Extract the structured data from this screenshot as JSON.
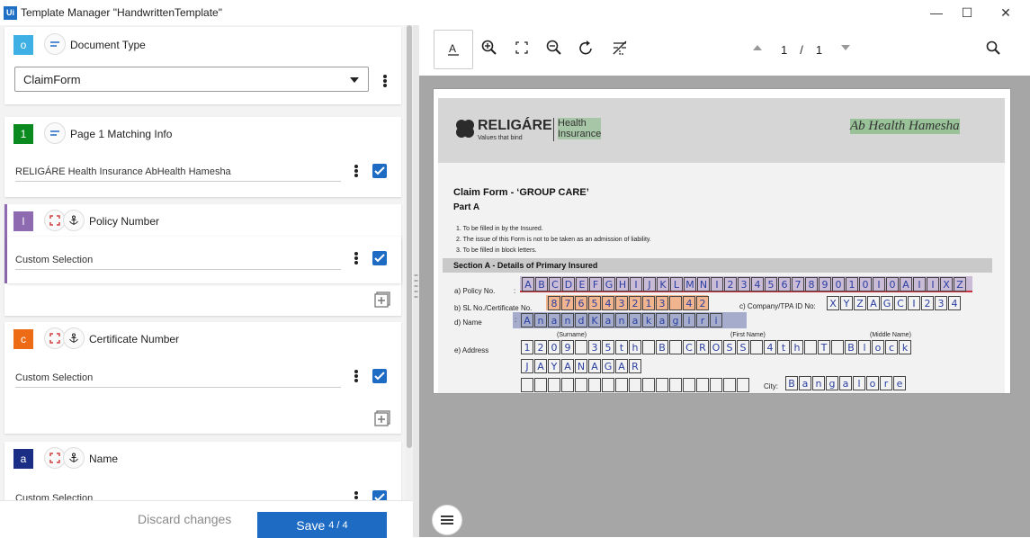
{
  "window": {
    "app_icon": "Ui",
    "title": "Template Manager \"HandwrittenTemplate\"",
    "minimize": "—",
    "maximize": "☐",
    "close": "✕"
  },
  "document_type": {
    "badge": "o",
    "badge_color": "#3fb0e4",
    "label": "Document Type",
    "selected": "ClaimForm"
  },
  "cards": [
    {
      "badge": "1",
      "badge_color": "#0b8a1f",
      "title": "Page 1 Matching Info",
      "value": "RELIGÁRE Health Insurance AbHealth Hamesha",
      "checked": true
    },
    {
      "badge": "l",
      "badge_color": "#8e6ab0",
      "title": "Policy Number",
      "value": "Custom Selection",
      "checked": true
    },
    {
      "badge": "c",
      "badge_color": "#ee6b15",
      "title": "Certificate Number",
      "value": "Custom Selection",
      "checked": true
    },
    {
      "badge": "a",
      "badge_color": "#1a2e86",
      "title": "Name",
      "value": "Custom Selection",
      "checked": true
    }
  ],
  "footer": {
    "discard": "Discard changes",
    "save": "Save",
    "save_count": "4 / 4"
  },
  "viewer": {
    "page_current": "1",
    "page_sep": "/",
    "page_total": "1"
  },
  "form": {
    "brand": "RELIGÁRE",
    "brand_tagline": "Values that bind",
    "product": "Health\nInsurance",
    "slogan": "Ab Health Hamesha",
    "title": "Claim Form - ‘GROUP CARE’",
    "part": "Part A",
    "instructions": [
      "1. To be filled in by the Insured.",
      "2. The issue of this Form is not to be taken as an admission of liability.",
      "3. To be filled in block letters."
    ],
    "section_a": "Section A - Details of Primary Insured",
    "policy_label": "a) Policy No.",
    "policy_value": "ABCDEFGHIJKLMNI23456789010I0AIIXZ",
    "sl_label": "b) SL No./Certificate No.",
    "sl_value": "876543213 42",
    "company_label": "c) Company/TPA ID No:",
    "company_value": "XYZAGCI234",
    "name_label": "d) Name",
    "name_value": "AnandKanakagiri",
    "surname_label": "(Surname)",
    "first_label": "(First Name)",
    "middle_label": "(Middle Name)",
    "address_label": "e) Address",
    "address_line1": "1209 35th B CROSS 4th T Block",
    "address_line2": "JAYANAGAR",
    "city_label": "City:",
    "city_value": "Bangalore"
  }
}
